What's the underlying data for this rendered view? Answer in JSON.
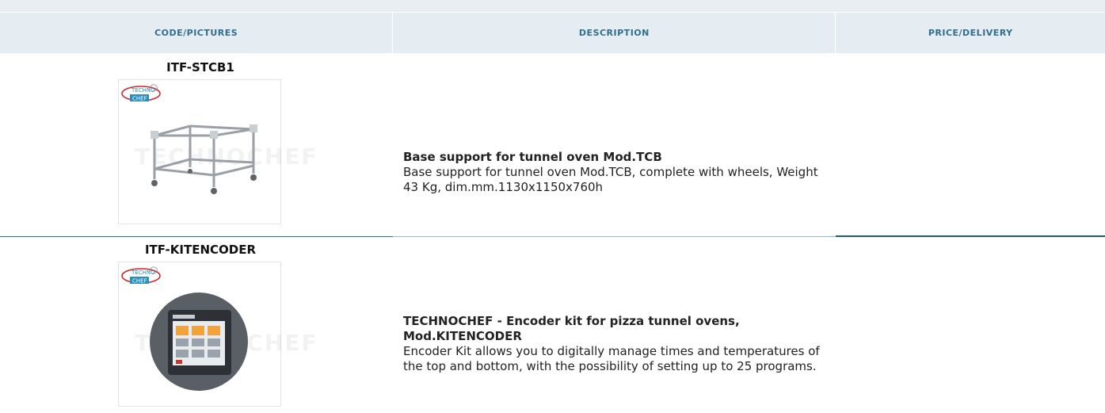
{
  "header": {
    "col_code": "CODE/PICTURES",
    "col_desc": "DESCRIPTION",
    "col_price": "PRICE/DELIVERY"
  },
  "products": [
    {
      "code": "ITF-STCB1",
      "logo_top": "TECHNO",
      "logo_bottom": "CHEF",
      "picture_icon": "oven-base-stand-image",
      "title": "Base support for tunnel oven Mod.TCB",
      "description": "Base support for tunnel oven Mod.TCB, complete with wheels, Weight 43 Kg, dim.mm.1130x1150x760h",
      "price": ""
    },
    {
      "code": "ITF-KITENCODER",
      "logo_top": "TECHNO",
      "logo_bottom": "CHEF",
      "picture_icon": "encoder-touch-panel-image",
      "title": "TECHNOCHEF - Encoder kit for pizza tunnel ovens, Mod.KITENCODER",
      "description": "Encoder Kit allows you to digitally manage times and temperatures of the top and bottom, with the possibility of setting up to 25 programs.",
      "price": ""
    }
  ],
  "colors": {
    "header_bg": "#e6edf2",
    "header_text": "#2f6e8e",
    "divider": "#2f6e8e"
  }
}
